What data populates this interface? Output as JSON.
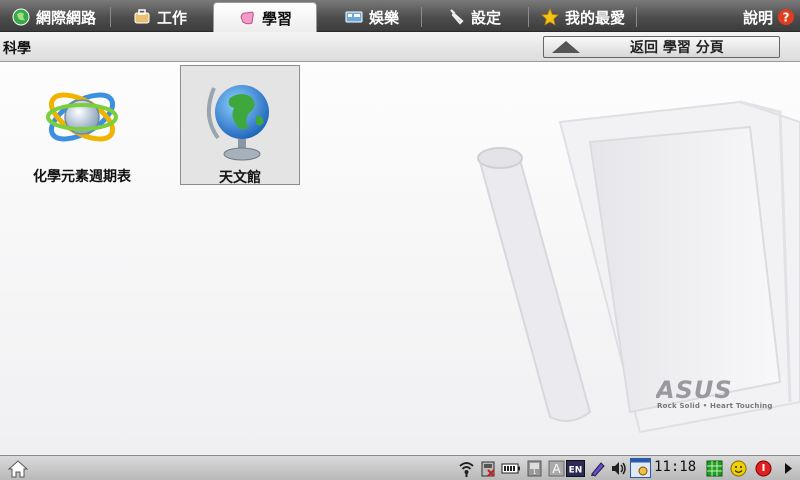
{
  "tabs": [
    {
      "label": "網際網路",
      "icon": "globe-icon",
      "active": false
    },
    {
      "label": "工作",
      "icon": "briefcase-icon",
      "active": false
    },
    {
      "label": "學習",
      "icon": "hand-icon",
      "active": true
    },
    {
      "label": "娛樂",
      "icon": "media-icon",
      "active": false
    },
    {
      "label": "設定",
      "icon": "wrench-icon",
      "active": false
    },
    {
      "label": "我的最愛",
      "icon": "star-icon",
      "active": false
    }
  ],
  "help": {
    "label": "說明",
    "icon": "help-icon"
  },
  "category": {
    "title": "科學",
    "back_label": "返回 學習 分頁"
  },
  "apps": [
    {
      "label": "化學元素週期表",
      "icon": "atom-icon",
      "selected": false
    },
    {
      "label": "天文館",
      "icon": "globe-stand-icon",
      "selected": true
    }
  ],
  "branding": {
    "logo": "ASUS",
    "tagline": "Rock Solid • Heart Touching"
  },
  "taskbar": {
    "home_icon": "home-icon",
    "tray_icons": [
      "network-icon",
      "disk-icon",
      "battery-icon",
      "keyboard-icon",
      "font-icon",
      "language-icon",
      "pen-icon",
      "volume-icon",
      "calendar-icon",
      "grid-icon",
      "smiley-icon",
      "power-icon",
      "arrow-right-icon"
    ],
    "language": "EN",
    "clock": "11:18"
  },
  "colors": {
    "help": "#e03c20",
    "power": "#e02020",
    "smiley": "#f0d000",
    "grid": "#20a020"
  }
}
